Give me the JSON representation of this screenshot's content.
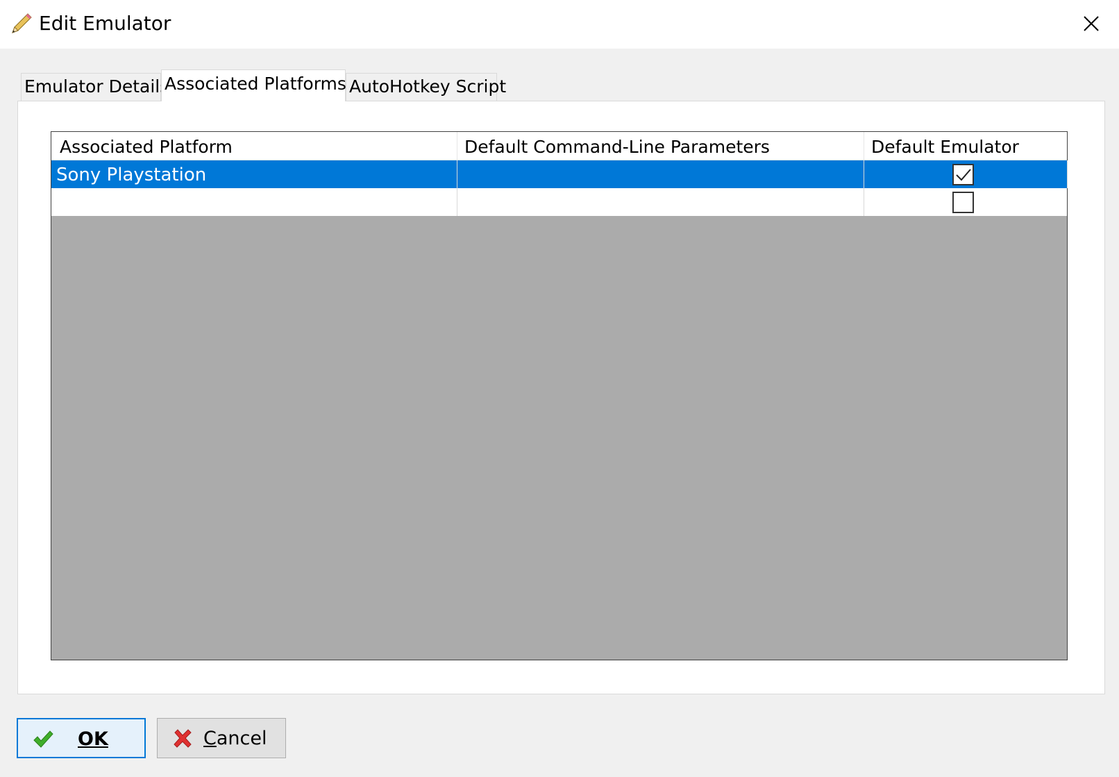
{
  "window": {
    "title": "Edit Emulator",
    "title_icon": "pencil-icon",
    "close_icon": "close-icon"
  },
  "tabs": [
    {
      "label": "Emulator Details",
      "active": false
    },
    {
      "label": "Associated Platforms",
      "active": true
    },
    {
      "label": "AutoHotkey Script",
      "active": false
    }
  ],
  "grid": {
    "columns": [
      "Associated Platform",
      "Default Command-Line Parameters",
      "Default Emulator"
    ],
    "rows": [
      {
        "platform": "Sony Playstation",
        "parameters": "",
        "default_emulator": true,
        "selected": true
      },
      {
        "platform": "",
        "parameters": "",
        "default_emulator": false,
        "selected": false
      }
    ],
    "colors": {
      "selection": "#0078d7",
      "empty_area": "#ababab"
    }
  },
  "buttons": {
    "ok": {
      "label": "OK",
      "icon": "checkmark-icon",
      "icon_color": "#3fae29"
    },
    "cancel": {
      "label_first": "C",
      "label_rest": "ancel",
      "icon": "red-x-icon",
      "icon_color": "#e03131"
    }
  }
}
